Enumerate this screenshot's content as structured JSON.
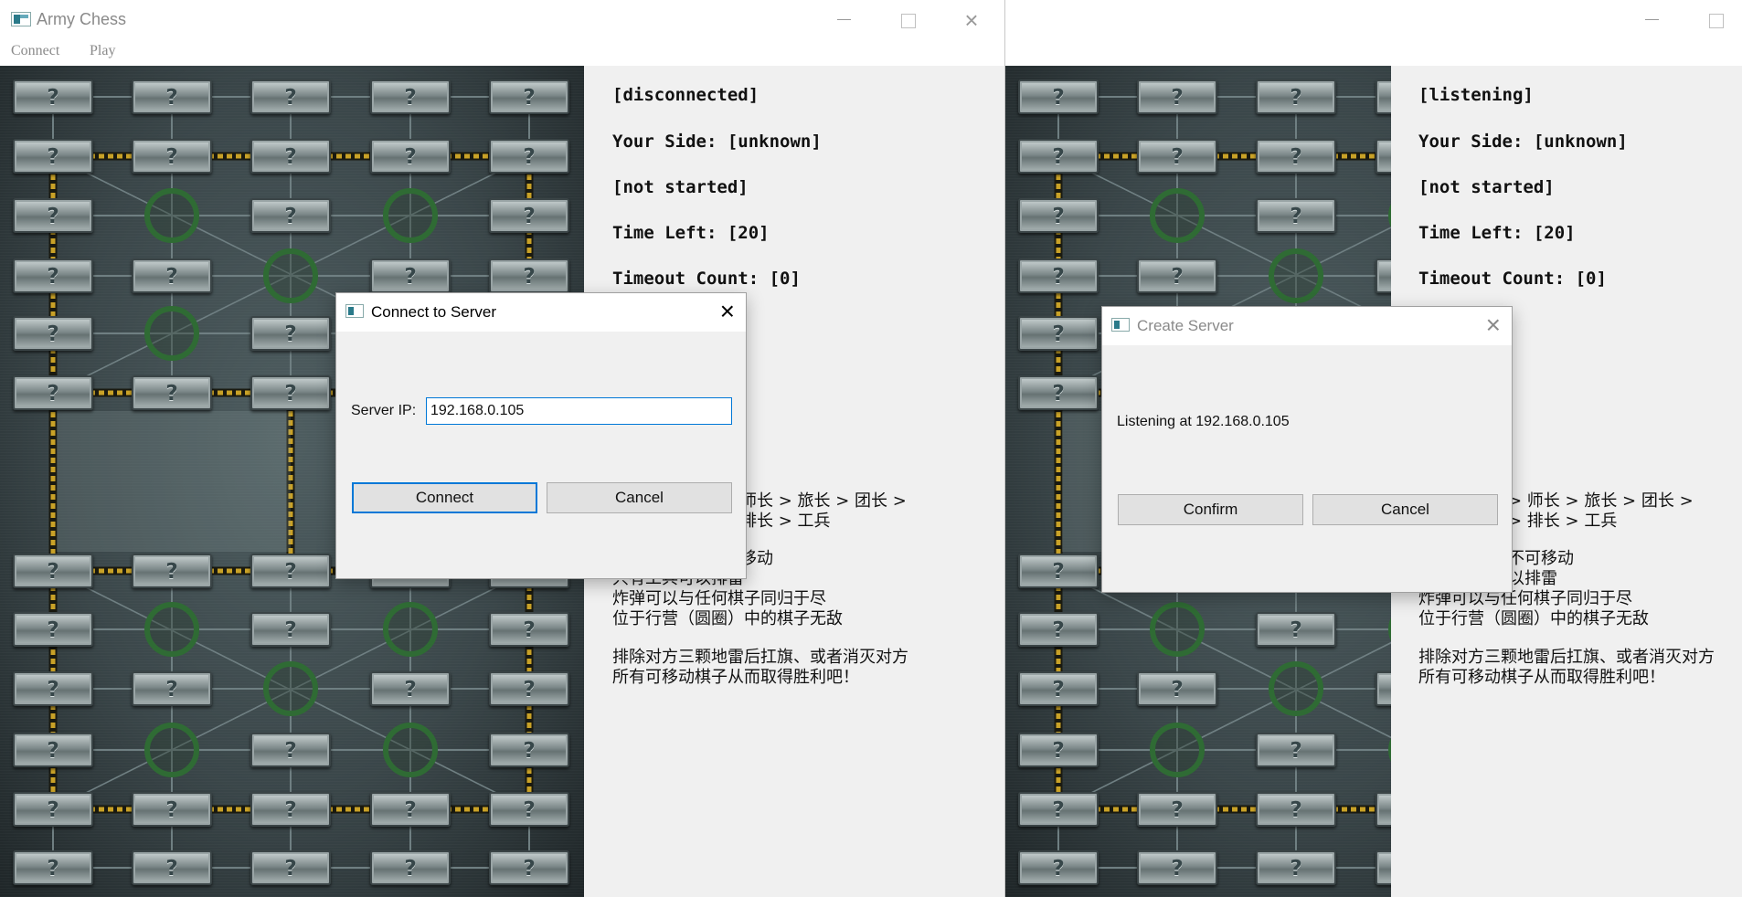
{
  "left_window": {
    "title": "Army Chess",
    "menu": [
      "Connect",
      "Play"
    ],
    "status": {
      "connection": "[disconnected]",
      "side": "Your Side: [unknown]",
      "game": "[not started]",
      "time_left": "Time Left: [20]",
      "timeout": "Timeout Count: [0]"
    },
    "rules_partial": {
      "line1": "师长 > 旅长 > 团长 >",
      "line2": "排长 > 工兵",
      "line3": "移动",
      "line4": "只有工兵可以排雷",
      "line5": "炸弹可以与任何棋子同归于尽",
      "line6": "位于行营（圆圈）中的棋子无敌",
      "line7": "排除对方三颗地雷后扛旗、或者消灭对方",
      "line8": "所有可移动棋子从而取得胜利吧！"
    }
  },
  "right_window": {
    "status": {
      "connection": "[listening]",
      "side": "Your Side: [unknown]",
      "game": "[not started]",
      "time_left": "Time Left: [20]",
      "timeout": "Timeout Count: [0]"
    },
    "rules_partial": {
      "line1": "> 师长 > 旅长 > 团长 >",
      "line2": "> 排长 > 工兵",
      "line3": "不可移动",
      "line4": "以排雷",
      "line5": "炸弹可以与任何棋子同归于尽",
      "line6": "位于行营（圆圈）中的棋子无敌",
      "line7": "排除对方三颗地雷后扛旗、或者消灭对方",
      "line8": "所有可移动棋子从而取得胜利吧！"
    }
  },
  "piece_label": "?",
  "connect_dialog": {
    "title": "Connect to Server",
    "ip_label": "Server IP:",
    "ip_value": "192.168.0.105",
    "connect_button": "Connect",
    "cancel_button": "Cancel"
  },
  "create_dialog": {
    "title": "Create Server",
    "message": "Listening at 192.168.0.105",
    "confirm_button": "Confirm",
    "cancel_button": "Cancel"
  },
  "colors": {
    "accent": "#0078d7",
    "board_dark": "#2a3335",
    "rail_yellow": "#c9a227",
    "camp_green": "#2f6b34"
  }
}
